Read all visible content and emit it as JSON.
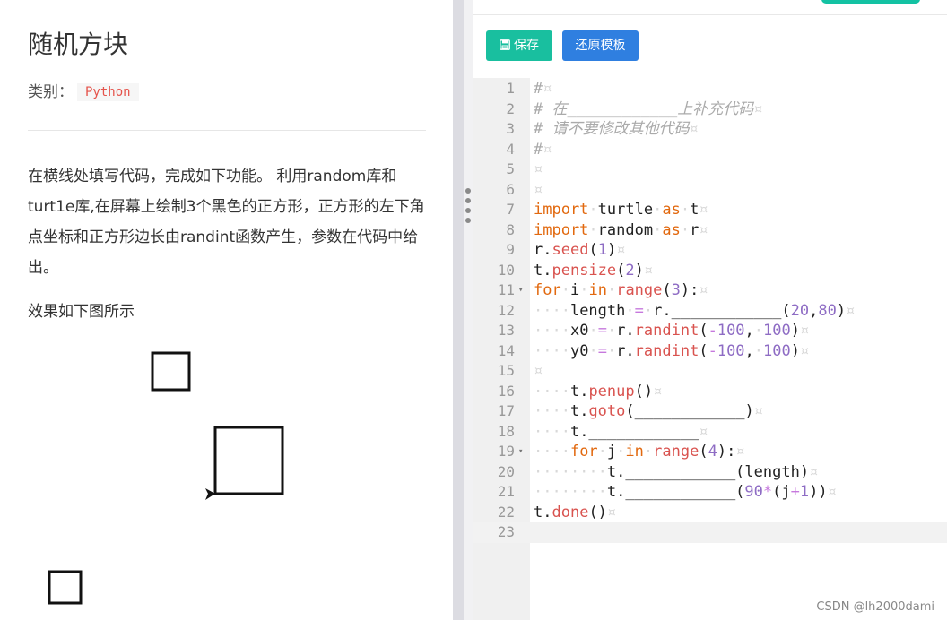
{
  "problem": {
    "title": "随机方块",
    "category_label": "类别：",
    "category": "Python",
    "description": "在横线处填写代码，完成如下功能。 利用random库和turt1e库,在屏幕上绘制3个黑色的正方形，正方形的左下角点坐标和正方形边长由randint函数产生，参数在代码中给出。",
    "effect_text": "效果如下图所示"
  },
  "toolbar": {
    "save_label": "保存",
    "restore_label": "还原模板"
  },
  "editor": {
    "lines": [
      {
        "n": "1",
        "fold": "",
        "tokens": [
          [
            "cm",
            "#"
          ],
          [
            "ws",
            "¤"
          ]
        ]
      },
      {
        "n": "2",
        "fold": "",
        "tokens": [
          [
            "cm",
            "# 在____________上补充代码"
          ],
          [
            "ws",
            "¤"
          ]
        ]
      },
      {
        "n": "3",
        "fold": "",
        "tokens": [
          [
            "cm",
            "# 请不要修改其他代码"
          ],
          [
            "ws",
            "¤"
          ]
        ]
      },
      {
        "n": "4",
        "fold": "",
        "tokens": [
          [
            "cm",
            "#"
          ],
          [
            "ws",
            "¤"
          ]
        ]
      },
      {
        "n": "5",
        "fold": "",
        "tokens": [
          [
            "ws",
            "¤"
          ]
        ]
      },
      {
        "n": "6",
        "fold": "",
        "tokens": [
          [
            "ws",
            "¤"
          ]
        ]
      },
      {
        "n": "7",
        "fold": "",
        "tokens": [
          [
            "kw",
            "import"
          ],
          [
            "ws",
            "·"
          ],
          [
            "t",
            "turtle"
          ],
          [
            "ws",
            "·"
          ],
          [
            "kw",
            "as"
          ],
          [
            "ws",
            "·"
          ],
          [
            "t",
            "t"
          ],
          [
            "ws",
            "¤"
          ]
        ]
      },
      {
        "n": "8",
        "fold": "",
        "tokens": [
          [
            "kw",
            "import"
          ],
          [
            "ws",
            "·"
          ],
          [
            "t",
            "random"
          ],
          [
            "ws",
            "·"
          ],
          [
            "kw",
            "as"
          ],
          [
            "ws",
            "·"
          ],
          [
            "t",
            "r"
          ],
          [
            "ws",
            "¤"
          ]
        ]
      },
      {
        "n": "9",
        "fold": "",
        "tokens": [
          [
            "t",
            "r."
          ],
          [
            "fn",
            "seed"
          ],
          [
            "t",
            "("
          ],
          [
            "num",
            "1"
          ],
          [
            "t",
            ")"
          ],
          [
            "ws",
            "¤"
          ]
        ]
      },
      {
        "n": "10",
        "fold": "",
        "tokens": [
          [
            "t",
            "t."
          ],
          [
            "fn",
            "pensize"
          ],
          [
            "t",
            "("
          ],
          [
            "num",
            "2"
          ],
          [
            "t",
            ")"
          ],
          [
            "ws",
            "¤"
          ]
        ]
      },
      {
        "n": "11",
        "fold": "▾",
        "tokens": [
          [
            "kw",
            "for"
          ],
          [
            "ws",
            "·"
          ],
          [
            "t",
            "i"
          ],
          [
            "ws",
            "·"
          ],
          [
            "kw",
            "in"
          ],
          [
            "ws",
            "·"
          ],
          [
            "fn",
            "range"
          ],
          [
            "t",
            "("
          ],
          [
            "num",
            "3"
          ],
          [
            "t",
            "):"
          ],
          [
            "ws",
            "¤"
          ]
        ]
      },
      {
        "n": "12",
        "fold": "",
        "tokens": [
          [
            "ws",
            "····"
          ],
          [
            "t",
            "length"
          ],
          [
            "ws",
            "·"
          ],
          [
            "op",
            "="
          ],
          [
            "ws",
            "·"
          ],
          [
            "t",
            "r.____________("
          ],
          [
            "num",
            "20"
          ],
          [
            "t",
            ","
          ],
          [
            "num",
            "80"
          ],
          [
            "t",
            ")"
          ],
          [
            "ws",
            "¤"
          ]
        ]
      },
      {
        "n": "13",
        "fold": "",
        "tokens": [
          [
            "ws",
            "····"
          ],
          [
            "t",
            "x0"
          ],
          [
            "ws",
            "·"
          ],
          [
            "op",
            "="
          ],
          [
            "ws",
            "·"
          ],
          [
            "t",
            "r."
          ],
          [
            "fn",
            "randint"
          ],
          [
            "t",
            "("
          ],
          [
            "op",
            "-"
          ],
          [
            "num",
            "100"
          ],
          [
            "t",
            ","
          ],
          [
            "ws",
            "·"
          ],
          [
            "num",
            "100"
          ],
          [
            "t",
            ")"
          ],
          [
            "ws",
            "¤"
          ]
        ]
      },
      {
        "n": "14",
        "fold": "",
        "tokens": [
          [
            "ws",
            "····"
          ],
          [
            "t",
            "y0"
          ],
          [
            "ws",
            "·"
          ],
          [
            "op",
            "="
          ],
          [
            "ws",
            "·"
          ],
          [
            "t",
            "r."
          ],
          [
            "fn",
            "randint"
          ],
          [
            "t",
            "("
          ],
          [
            "op",
            "-"
          ],
          [
            "num",
            "100"
          ],
          [
            "t",
            ","
          ],
          [
            "ws",
            "·"
          ],
          [
            "num",
            "100"
          ],
          [
            "t",
            ")"
          ],
          [
            "ws",
            "¤"
          ]
        ]
      },
      {
        "n": "15",
        "fold": "",
        "tokens": [
          [
            "ws",
            "¤"
          ]
        ]
      },
      {
        "n": "16",
        "fold": "",
        "tokens": [
          [
            "ws",
            "····"
          ],
          [
            "t",
            "t."
          ],
          [
            "fn",
            "penup"
          ],
          [
            "t",
            "()"
          ],
          [
            "ws",
            "¤"
          ]
        ]
      },
      {
        "n": "17",
        "fold": "",
        "tokens": [
          [
            "ws",
            "····"
          ],
          [
            "t",
            "t."
          ],
          [
            "fn",
            "goto"
          ],
          [
            "t",
            "(____________)"
          ],
          [
            "ws",
            "¤"
          ]
        ]
      },
      {
        "n": "18",
        "fold": "",
        "tokens": [
          [
            "ws",
            "····"
          ],
          [
            "t",
            "t.____________"
          ],
          [
            "ws",
            "¤"
          ]
        ]
      },
      {
        "n": "19",
        "fold": "▾",
        "tokens": [
          [
            "ws",
            "····"
          ],
          [
            "kw",
            "for"
          ],
          [
            "ws",
            "·"
          ],
          [
            "t",
            "j"
          ],
          [
            "ws",
            "·"
          ],
          [
            "kw",
            "in"
          ],
          [
            "ws",
            "·"
          ],
          [
            "fn",
            "range"
          ],
          [
            "t",
            "("
          ],
          [
            "num",
            "4"
          ],
          [
            "t",
            "):"
          ],
          [
            "ws",
            "¤"
          ]
        ]
      },
      {
        "n": "20",
        "fold": "",
        "tokens": [
          [
            "ws",
            "········"
          ],
          [
            "t",
            "t.____________(length)"
          ],
          [
            "ws",
            "¤"
          ]
        ]
      },
      {
        "n": "21",
        "fold": "",
        "tokens": [
          [
            "ws",
            "········"
          ],
          [
            "t",
            "t.____________("
          ],
          [
            "num",
            "90"
          ],
          [
            "op",
            "*"
          ],
          [
            "t",
            "(j"
          ],
          [
            "op",
            "+"
          ],
          [
            "num",
            "1"
          ],
          [
            "t",
            "))"
          ],
          [
            "ws",
            "¤"
          ]
        ]
      },
      {
        "n": "22",
        "fold": "",
        "tokens": [
          [
            "t",
            "t."
          ],
          [
            "fn",
            "done"
          ],
          [
            "t",
            "()"
          ],
          [
            "ws",
            "¤"
          ]
        ]
      },
      {
        "n": "23",
        "fold": "",
        "tokens": []
      }
    ],
    "active_line": "23"
  },
  "watermark": "CSDN @lh2000dami"
}
